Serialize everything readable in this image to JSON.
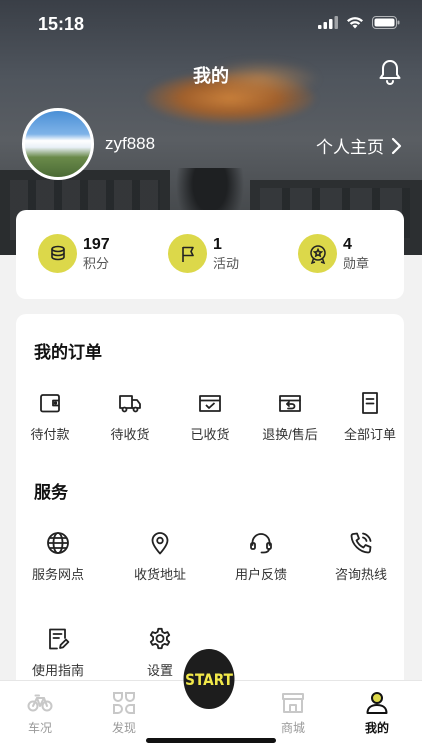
{
  "status": {
    "time": "15:18"
  },
  "header": {
    "title": "我的"
  },
  "profile": {
    "username": "zyf888",
    "homepage_label": "个人主页"
  },
  "stats": [
    {
      "value": "197",
      "label": "积分",
      "icon": "coins-icon"
    },
    {
      "value": "1",
      "label": "活动",
      "icon": "flag-icon"
    },
    {
      "value": "4",
      "label": "勋章",
      "icon": "medal-icon"
    }
  ],
  "orders": {
    "title": "我的订单",
    "items": [
      {
        "label": "待付款",
        "icon": "wallet-icon"
      },
      {
        "label": "待收货",
        "icon": "truck-icon"
      },
      {
        "label": "已收货",
        "icon": "received-box-icon"
      },
      {
        "label": "退换/售后",
        "icon": "return-box-icon"
      },
      {
        "label": "全部订单",
        "icon": "document-icon"
      }
    ]
  },
  "services": {
    "title": "服务",
    "items": [
      {
        "label": "服务网点",
        "icon": "globe-icon"
      },
      {
        "label": "收货地址",
        "icon": "location-pin-icon"
      },
      {
        "label": "用户反馈",
        "icon": "headset-icon"
      },
      {
        "label": "咨询热线",
        "icon": "phone-call-icon"
      },
      {
        "label": "使用指南",
        "icon": "guide-icon"
      },
      {
        "label": "设置",
        "icon": "gear-icon"
      }
    ]
  },
  "tabbar": {
    "start_label": "START",
    "tabs": [
      {
        "label": "车况",
        "icon": "bike-icon"
      },
      {
        "label": "发现",
        "icon": "discover-icon"
      },
      {
        "label": "商城",
        "icon": "shop-icon"
      },
      {
        "label": "我的",
        "icon": "user-icon",
        "active": true
      }
    ]
  },
  "colors": {
    "accent": "#dcd84a",
    "start_text": "#f2e94a",
    "start_bg": "#1d1d1d"
  }
}
